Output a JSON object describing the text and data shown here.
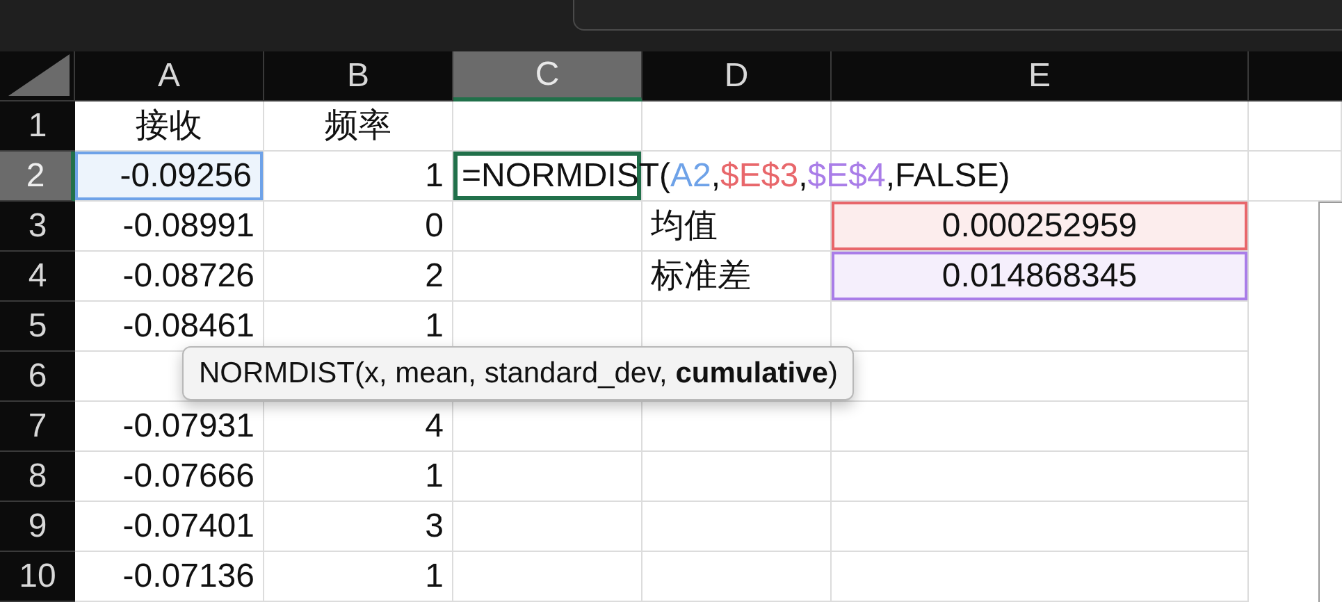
{
  "columns": [
    {
      "label": "A",
      "selected": false
    },
    {
      "label": "B",
      "selected": false
    },
    {
      "label": "C",
      "selected": true
    },
    {
      "label": "D",
      "selected": false
    },
    {
      "label": "E",
      "selected": false
    }
  ],
  "rows": [
    {
      "number": "1",
      "selected": false,
      "cells": [
        {
          "kind": "header",
          "text": "接收"
        },
        {
          "kind": "header",
          "text": "频率"
        },
        {
          "kind": "empty"
        },
        {
          "kind": "empty"
        },
        {
          "kind": "empty"
        }
      ]
    },
    {
      "number": "2",
      "selected": true,
      "cells": [
        {
          "kind": "number",
          "text": "-0.09256",
          "color": "#6ea2e8"
        },
        {
          "kind": "number",
          "text": "1"
        },
        {
          "kind": "formula",
          "active": true,
          "parts": [
            {
              "text": "=NORMDIST(",
              "color": "#111111"
            },
            {
              "text": "A2",
              "color": "#6ea2e8"
            },
            {
              "text": ",",
              "color": "#111111"
            },
            {
              "text": "$E$3",
              "color": "#e8676b"
            },
            {
              "text": ",",
              "color": "#111111"
            },
            {
              "text": "$E$4",
              "color": "#a97de8"
            },
            {
              "text": ",FALSE)",
              "color": "#111111"
            }
          ]
        },
        {
          "kind": "empty"
        },
        {
          "kind": "empty"
        }
      ]
    },
    {
      "number": "3",
      "selected": false,
      "cells": [
        {
          "kind": "number",
          "text": "-0.08991"
        },
        {
          "kind": "number",
          "text": "0"
        },
        {
          "kind": "empty"
        },
        {
          "kind": "label",
          "text": "均值"
        },
        {
          "kind": "value",
          "text": "0.000252959",
          "color": "#e8676b"
        }
      ]
    },
    {
      "number": "4",
      "selected": false,
      "cells": [
        {
          "kind": "number",
          "text": "-0.08726"
        },
        {
          "kind": "number",
          "text": "2"
        },
        {
          "kind": "empty"
        },
        {
          "kind": "label",
          "text": "标准差"
        },
        {
          "kind": "value",
          "text": "0.014868345",
          "color": "#a97de8"
        }
      ]
    },
    {
      "number": "5",
      "selected": false,
      "cells": [
        {
          "kind": "number",
          "text": "-0.08461"
        },
        {
          "kind": "number",
          "text": "1"
        },
        {
          "kind": "empty"
        },
        {
          "kind": "empty"
        },
        {
          "kind": "empty"
        }
      ]
    },
    {
      "number": "6",
      "selected": false,
      "cells": [
        {
          "kind": "empty"
        },
        {
          "kind": "empty"
        },
        {
          "kind": "empty"
        },
        {
          "kind": "empty"
        },
        {
          "kind": "empty"
        }
      ]
    },
    {
      "number": "7",
      "selected": false,
      "cells": [
        {
          "kind": "number",
          "text": "-0.07931"
        },
        {
          "kind": "number",
          "text": "4"
        },
        {
          "kind": "empty"
        },
        {
          "kind": "empty"
        },
        {
          "kind": "empty"
        }
      ]
    },
    {
      "number": "8",
      "selected": false,
      "cells": [
        {
          "kind": "number",
          "text": "-0.07666"
        },
        {
          "kind": "number",
          "text": "1"
        },
        {
          "kind": "empty"
        },
        {
          "kind": "empty"
        },
        {
          "kind": "empty"
        }
      ]
    },
    {
      "number": "9",
      "selected": false,
      "cells": [
        {
          "kind": "number",
          "text": "-0.07401"
        },
        {
          "kind": "number",
          "text": "3"
        },
        {
          "kind": "empty"
        },
        {
          "kind": "empty"
        },
        {
          "kind": "empty"
        }
      ]
    },
    {
      "number": "10",
      "selected": false,
      "cells": [
        {
          "kind": "number",
          "text": "-0.07136"
        },
        {
          "kind": "number",
          "text": "1"
        },
        {
          "kind": "empty"
        },
        {
          "kind": "empty"
        },
        {
          "kind": "empty"
        }
      ]
    }
  ],
  "tooltip": {
    "text": "NORMDIST(x, mean, standard_dev, **cumulative**)"
  }
}
